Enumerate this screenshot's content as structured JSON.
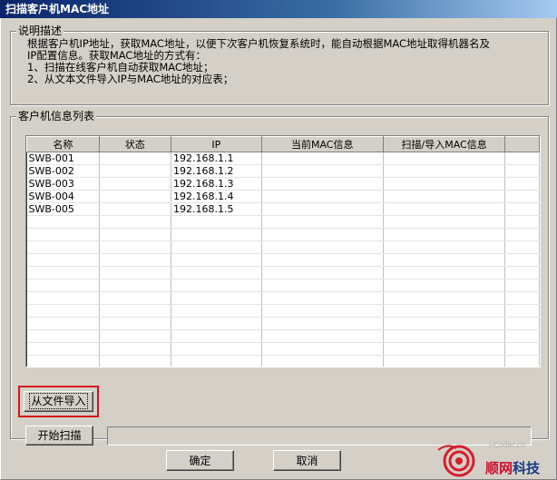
{
  "window": {
    "title": "扫描客户机MAC地址"
  },
  "description": {
    "group_label": "说明描述",
    "lines": [
      "根据客户机IP地址，获取MAC地址，以便下次客户机恢复系统时，能自动根据MAC地址取得机器名及",
      "IP配置信息。获取MAC地址的方式有：",
      "1、扫描在线客户机自动获取MAC地址；",
      "2、从文本文件导入IP与MAC地址的对应表；"
    ]
  },
  "client_list": {
    "group_label": "客户机信息列表",
    "columns": [
      "名称",
      "状态",
      "IP",
      "当前MAC信息",
      "扫描/导入MAC信息"
    ],
    "rows": [
      [
        "SWB-001",
        "",
        "192.168.1.1",
        "",
        ""
      ],
      [
        "SWB-002",
        "",
        "192.168.1.2",
        "",
        ""
      ],
      [
        "SWB-003",
        "",
        "192.168.1.3",
        "",
        ""
      ],
      [
        "SWB-004",
        "",
        "192.168.1.4",
        "",
        ""
      ],
      [
        "SWB-005",
        "",
        "192.168.1.5",
        "",
        ""
      ]
    ],
    "empty_row_count": 12
  },
  "buttons": {
    "import": "从文件导入",
    "scan": "开始扫描",
    "ok": "确定",
    "cancel": "取消"
  },
  "scan_progress": 0,
  "colors": {
    "highlight": "#d8121a",
    "titlebar": "#0a246a",
    "face": "#d4d0c8"
  },
  "watermark": {
    "small": "i-Coder.cn",
    "brand_red": "顺网",
    "brand_blue": "科技"
  }
}
